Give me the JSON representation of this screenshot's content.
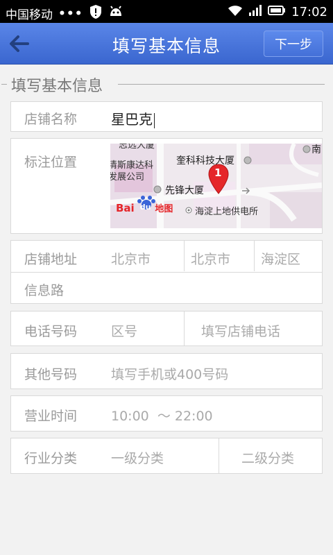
{
  "status_bar": {
    "carrier": "中国移动",
    "dots": "•••",
    "time": "17:02"
  },
  "header": {
    "title": "填写基本信息",
    "next_label": "下一步"
  },
  "section": {
    "title": "填写基本信息"
  },
  "form": {
    "store_name": {
      "label": "店铺名称",
      "value": "星巴克"
    },
    "location": {
      "label": "标注位置",
      "map": {
        "labels": {
          "top_road": "志远大厦",
          "company1": "清斯康达科",
          "company2": "发展公司",
          "building_main": "奎科科技大厦",
          "building_target": "先锋大厦",
          "power_station": "海淀上地供电所",
          "right_label": "南",
          "marker_number": "1",
          "baidu_prefix": "Bai",
          "baidu_paw": "du",
          "baidu_suffix": "地图"
        }
      }
    },
    "address": {
      "label": "店铺地址",
      "province": "北京市",
      "city": "北京市",
      "district": "海淀区",
      "street": "信息路"
    },
    "phone": {
      "label": "电话号码",
      "area_placeholder": "区号",
      "phone_placeholder": "填写店铺电话"
    },
    "other_phone": {
      "label": "其他号码",
      "placeholder": "填写手机或400号码"
    },
    "hours": {
      "label": "营业时间",
      "value": "10:00  ～ 22:00"
    },
    "category": {
      "label": "行业分类",
      "level1": "一级分类",
      "level2": "二级分类"
    }
  },
  "colors": {
    "header_bg": "#4775dc",
    "marker_red": "#e5262a"
  }
}
